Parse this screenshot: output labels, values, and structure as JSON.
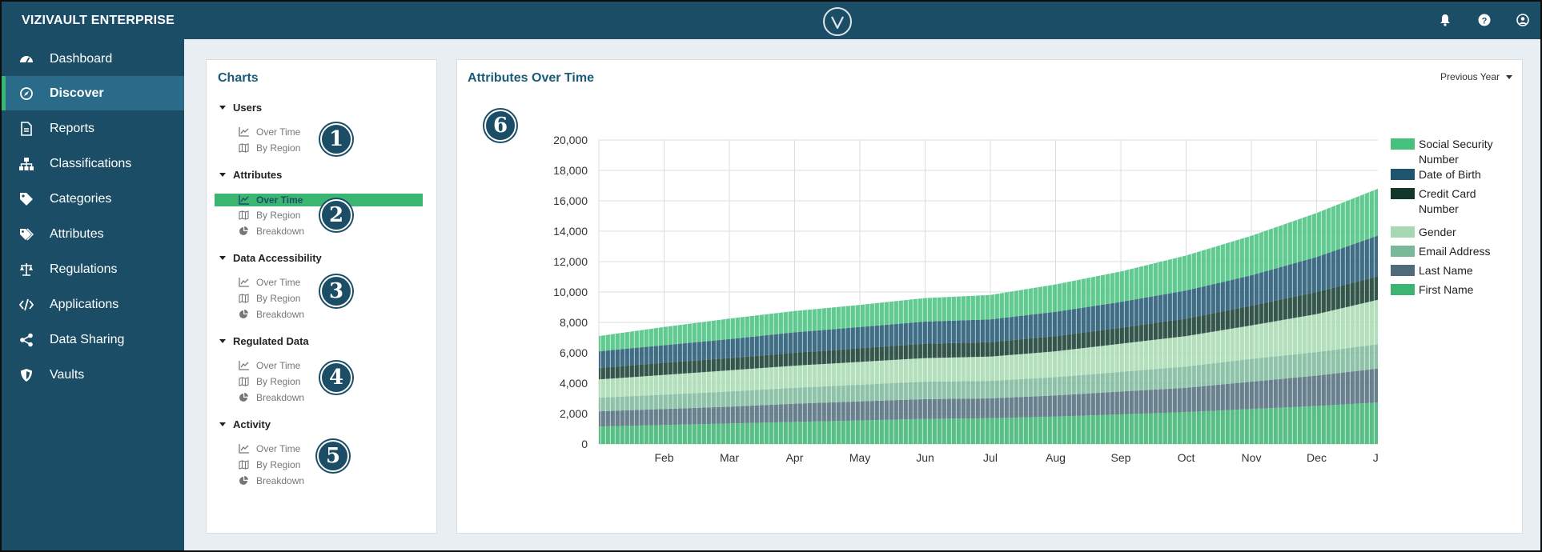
{
  "app": {
    "brand": "VIZIVAULT ENTERPRISE"
  },
  "topbar": {
    "icons": [
      "bell-icon",
      "help-icon",
      "user-icon"
    ]
  },
  "sidebar": {
    "items": [
      {
        "label": "Dashboard",
        "icon": "dashboard-icon",
        "active": false
      },
      {
        "label": "Discover",
        "icon": "compass-icon",
        "active": true
      },
      {
        "label": "Reports",
        "icon": "document-icon",
        "active": false
      },
      {
        "label": "Classifications",
        "icon": "hierarchy-icon",
        "active": false
      },
      {
        "label": "Categories",
        "icon": "tag-icon",
        "active": false
      },
      {
        "label": "Attributes",
        "icon": "tags-icon",
        "active": false
      },
      {
        "label": "Regulations",
        "icon": "scale-icon",
        "active": false
      },
      {
        "label": "Applications",
        "icon": "code-icon",
        "active": false
      },
      {
        "label": "Data Sharing",
        "icon": "share-icon",
        "active": false
      },
      {
        "label": "Vaults",
        "icon": "shield-icon",
        "active": false
      }
    ]
  },
  "charts_panel": {
    "title": "Charts",
    "groups": [
      {
        "label": "Users",
        "badge": "1",
        "items": [
          {
            "label": "Over Time",
            "icon": "line-chart-icon",
            "active": false
          },
          {
            "label": "By Region",
            "icon": "map-icon",
            "active": false
          }
        ]
      },
      {
        "label": "Attributes",
        "badge": "2",
        "items": [
          {
            "label": "Over Time",
            "icon": "line-chart-icon",
            "active": true
          },
          {
            "label": "By Region",
            "icon": "map-icon",
            "active": false
          },
          {
            "label": "Breakdown",
            "icon": "pie-chart-icon",
            "active": false
          }
        ]
      },
      {
        "label": "Data Accessibility",
        "badge": "3",
        "items": [
          {
            "label": "Over Time",
            "icon": "line-chart-icon",
            "active": false
          },
          {
            "label": "By Region",
            "icon": "map-icon",
            "active": false
          },
          {
            "label": "Breakdown",
            "icon": "pie-chart-icon",
            "active": false
          }
        ]
      },
      {
        "label": "Regulated Data",
        "badge": "4",
        "items": [
          {
            "label": "Over Time",
            "icon": "line-chart-icon",
            "active": false
          },
          {
            "label": "By Region",
            "icon": "map-icon",
            "active": false
          },
          {
            "label": "Breakdown",
            "icon": "pie-chart-icon",
            "active": false
          }
        ]
      },
      {
        "label": "Activity",
        "badge": "5",
        "items": [
          {
            "label": "Over Time",
            "icon": "line-chart-icon",
            "active": false
          },
          {
            "label": "By Region",
            "icon": "map-icon",
            "active": false
          },
          {
            "label": "Breakdown",
            "icon": "pie-chart-icon",
            "active": false
          }
        ]
      }
    ]
  },
  "main_panel": {
    "title": "Attributes Over Time",
    "badge": "6",
    "range_select": "Previous Year"
  },
  "colors": {
    "nav_bg": "#1b4e66",
    "nav_active": "#2a6b89",
    "accent_green": "#3bb572",
    "title_blue": "#1b5a78"
  },
  "chart_data": {
    "type": "area",
    "stacked": true,
    "x": [
      "Jan",
      "Feb",
      "Mar",
      "Apr",
      "May",
      "Jun",
      "Jul",
      "Aug",
      "Sep",
      "Oct",
      "Nov",
      "Dec",
      "Jan"
    ],
    "x_tick_labels": [
      "Feb",
      "Mar",
      "Apr",
      "May",
      "Jun",
      "Jul",
      "Aug",
      "Sep",
      "Oct",
      "Nov",
      "Dec",
      "Jan"
    ],
    "y_tick_labels": [
      "0",
      "2,000",
      "4,000",
      "6,000",
      "8,000",
      "10,000",
      "12,000",
      "14,000",
      "16,000",
      "18,000",
      "20,000"
    ],
    "ylim": [
      0,
      20000
    ],
    "grid": true,
    "legend_position": "right",
    "series": [
      {
        "name": "First Name",
        "color": "#3bb572",
        "values": [
          1150,
          1250,
          1350,
          1450,
          1550,
          1650,
          1700,
          1800,
          1950,
          2100,
          2300,
          2500,
          2750
        ]
      },
      {
        "name": "Last Name",
        "color": "#4f6a7a",
        "values": [
          1000,
          1050,
          1100,
          1200,
          1250,
          1300,
          1300,
          1400,
          1500,
          1600,
          1800,
          2000,
          2250
        ]
      },
      {
        "name": "Email Address",
        "color": "#7ab89a",
        "values": [
          900,
          950,
          1000,
          1050,
          1100,
          1150,
          1150,
          1200,
          1300,
          1400,
          1500,
          1550,
          1600
        ]
      },
      {
        "name": "Gender",
        "color": "#a6d9b1",
        "values": [
          1200,
          1300,
          1400,
          1450,
          1500,
          1550,
          1600,
          1700,
          1850,
          2000,
          2200,
          2500,
          2950
        ]
      },
      {
        "name": "Credit Card Number",
        "color": "#11382b",
        "values": [
          750,
          800,
          800,
          850,
          900,
          950,
          950,
          1000,
          1050,
          1150,
          1300,
          1450,
          1550
        ]
      },
      {
        "name": "Date of Birth",
        "color": "#1d5470",
        "values": [
          1100,
          1150,
          1250,
          1350,
          1400,
          1450,
          1500,
          1600,
          1700,
          1850,
          2000,
          2300,
          2700
        ]
      },
      {
        "name": "Social Security Number",
        "color": "#44c17d",
        "values": [
          1000,
          1200,
          1350,
          1400,
          1450,
          1550,
          1600,
          1800,
          2000,
          2300,
          2600,
          2900,
          3100
        ]
      }
    ]
  }
}
